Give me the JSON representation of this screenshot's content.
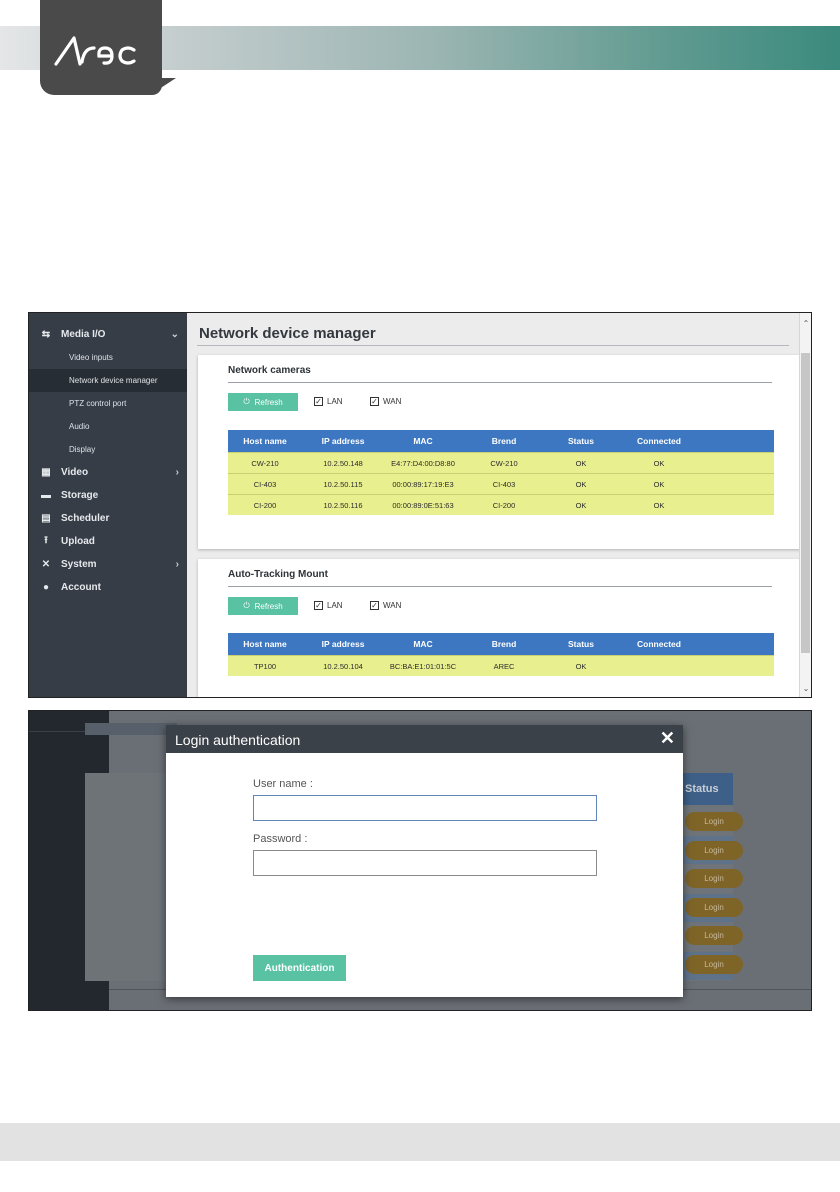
{
  "brand": {
    "logo_text": "Arec"
  },
  "sidebar": {
    "items": [
      {
        "label": "Media I/O",
        "icon": "media-io-icon",
        "glyph": "⇆",
        "chevron": "⌄"
      },
      {
        "label": "Video",
        "icon": "film-icon",
        "glyph": "▦",
        "chevron": "›"
      },
      {
        "label": "Storage",
        "icon": "storage-icon",
        "glyph": "▬",
        "chevron": ""
      },
      {
        "label": "Scheduler",
        "icon": "calendar-icon",
        "glyph": "▤",
        "chevron": ""
      },
      {
        "label": "Upload",
        "icon": "upload-icon",
        "glyph": "⭱",
        "chevron": ""
      },
      {
        "label": "System",
        "icon": "tools-icon",
        "glyph": "✕",
        "chevron": "›"
      },
      {
        "label": "Account",
        "icon": "user-icon",
        "glyph": "●",
        "chevron": ""
      }
    ],
    "subitems": [
      "Video inputs",
      "Network device manager",
      "PTZ control port",
      "Audio",
      "Display"
    ],
    "active_subitem": "Network device manager"
  },
  "page": {
    "title": "Network device manager"
  },
  "network_cameras": {
    "title": "Network cameras",
    "refresh_label": "Refresh",
    "lan_label": "LAN",
    "wan_label": "WAN",
    "columns": [
      "Host name",
      "IP address",
      "MAC",
      "Brend",
      "Status",
      "Connected"
    ],
    "rows": [
      [
        "CW-210",
        "10.2.50.148",
        "E4:77:D4:00:D8:80",
        "CW-210",
        "OK",
        "OK"
      ],
      [
        "CI-403",
        "10.2.50.115",
        "00:00:89:17:19:E3",
        "CI-403",
        "OK",
        "OK"
      ],
      [
        "CI-200",
        "10.2.50.116",
        "00:00:89:0E:51:63",
        "CI-200",
        "OK",
        "OK"
      ]
    ]
  },
  "auto_tracking": {
    "title": "Auto-Tracking Mount",
    "refresh_label": "Refresh",
    "lan_label": "LAN",
    "wan_label": "WAN",
    "columns": [
      "Host name",
      "IP address",
      "MAC",
      "Brend",
      "Status",
      "Connected"
    ],
    "rows": [
      [
        "TP100",
        "10.2.50.104",
        "BC:BA:E1:01:01:5C",
        "AREC",
        "OK",
        ""
      ]
    ]
  },
  "login_dialog": {
    "title": "Login authentication",
    "close_glyph": "✕",
    "username_label": "User name :",
    "username_value": "",
    "password_label": "Password :",
    "password_value": "",
    "submit_label": "Authentication"
  },
  "background_table": {
    "status_header": "Status",
    "login_label": "Login",
    "row_count": 6
  },
  "colors": {
    "accent": "#58c2a2",
    "table_header": "#3d77c1",
    "row_highlight": "#e7ef8f",
    "sidebar": "#363d47"
  }
}
